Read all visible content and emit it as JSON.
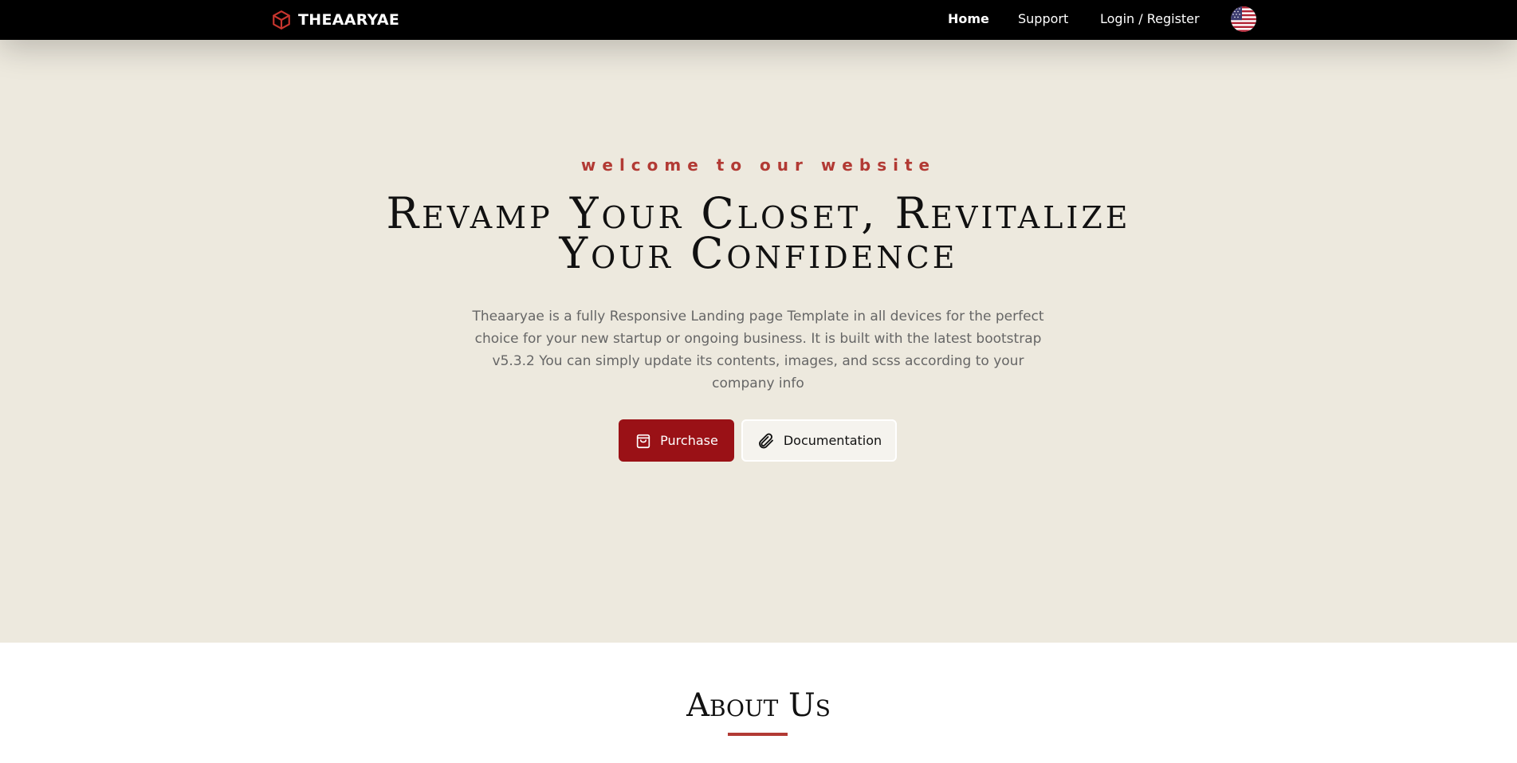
{
  "brand": {
    "name": "THEAARYAE",
    "icon": "cube-icon",
    "icon_color": "#c7352e"
  },
  "nav": {
    "home": "Home",
    "support": "Support",
    "login_register": "Login / Register",
    "language_icon": "us-flag-icon"
  },
  "hero": {
    "eyebrow": "welcome to our website",
    "headline_line1": "Revamp Your Closet, Revitalize",
    "headline_line2": "Your Confidence",
    "description": "Theaaryae is a fully Responsive Landing page Template in all devices for the perfect choice for your new startup or ongoing business. It is built with the latest bootstrap v5.3.2 You can simply update its contents, images, and scss according to your company info",
    "purchase_label": "Purchase",
    "purchase_icon": "shopping-bag-icon",
    "docs_label": "Documentation",
    "docs_icon": "paperclip-icon"
  },
  "about": {
    "title": "About Us"
  },
  "colors": {
    "navbar": "#000000",
    "hero_background": "#ede9de",
    "accent": "#b23a34",
    "primary_button": "#9a1116"
  }
}
